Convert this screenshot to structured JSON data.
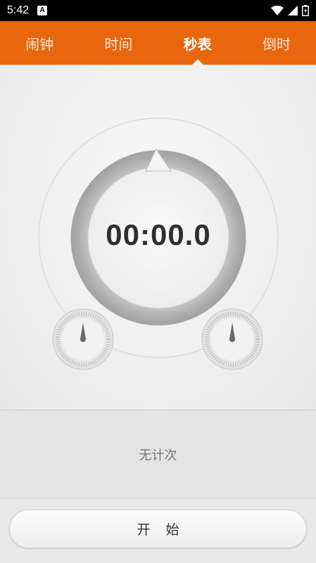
{
  "status_bar": {
    "time": "5:42",
    "notification_icon": "A",
    "icons": [
      "wifi-icon",
      "signal-icon",
      "battery-icon"
    ]
  },
  "tabs": [
    {
      "label": "闹钟",
      "active": false
    },
    {
      "label": "时间",
      "active": false
    },
    {
      "label": "秒表",
      "active": true
    },
    {
      "label": "倒时",
      "active": false
    }
  ],
  "stopwatch": {
    "readout": "00:00.0"
  },
  "laps": {
    "empty_text": "无计次"
  },
  "actions": {
    "start_label": "开始"
  },
  "colors": {
    "accent": "#e8660e",
    "ring": "#b5b5b5",
    "text_dark": "#2f2f2f"
  }
}
